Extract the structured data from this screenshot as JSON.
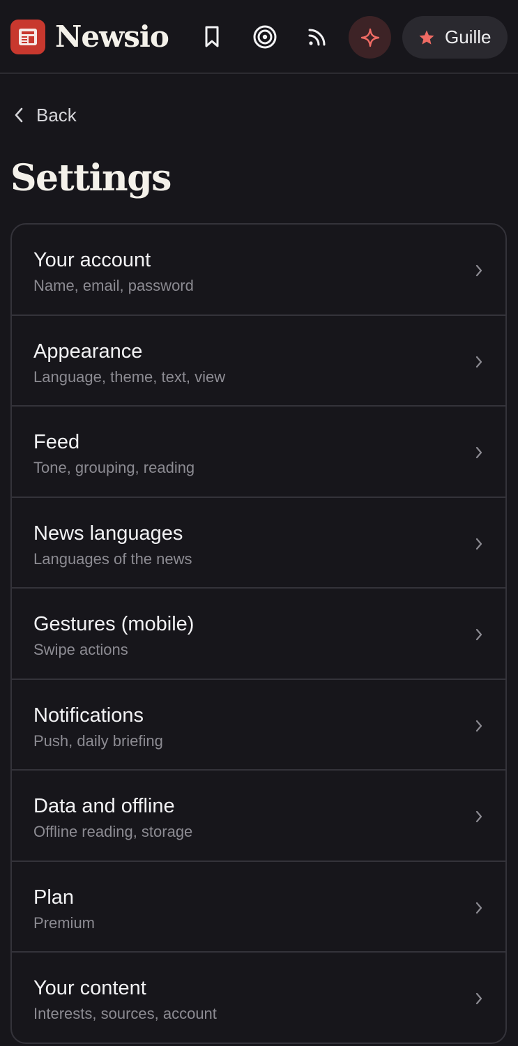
{
  "header": {
    "brand": "Newsio",
    "icons": [
      "newspaper-logo-icon",
      "bookmark-icon",
      "target-icon",
      "rss-icon",
      "sparkle-icon",
      "star-icon"
    ],
    "user_name": "Guille"
  },
  "nav": {
    "back_label": "Back"
  },
  "page": {
    "title": "Settings"
  },
  "settings": {
    "items": [
      {
        "title": "Your account",
        "subtitle": "Name, email, password"
      },
      {
        "title": "Appearance",
        "subtitle": "Language, theme, text, view"
      },
      {
        "title": "Feed",
        "subtitle": "Tone, grouping, reading"
      },
      {
        "title": "News languages",
        "subtitle": "Languages of the news"
      },
      {
        "title": "Gestures (mobile)",
        "subtitle": "Swipe actions"
      },
      {
        "title": "Notifications",
        "subtitle": "Push, daily briefing"
      },
      {
        "title": "Data and offline",
        "subtitle": "Offline reading, storage"
      },
      {
        "title": "Plan",
        "subtitle": "Premium"
      },
      {
        "title": "Your content",
        "subtitle": "Interests, sources, account"
      }
    ]
  },
  "colors": {
    "background": "#17161b",
    "brand_red": "#c8382e",
    "accent_coral": "#ef6b64",
    "sparkle_bg": "#3d2326",
    "pill_bg": "#2a292f",
    "divider": "#34333a",
    "subtitle_text": "#8c8b92"
  }
}
